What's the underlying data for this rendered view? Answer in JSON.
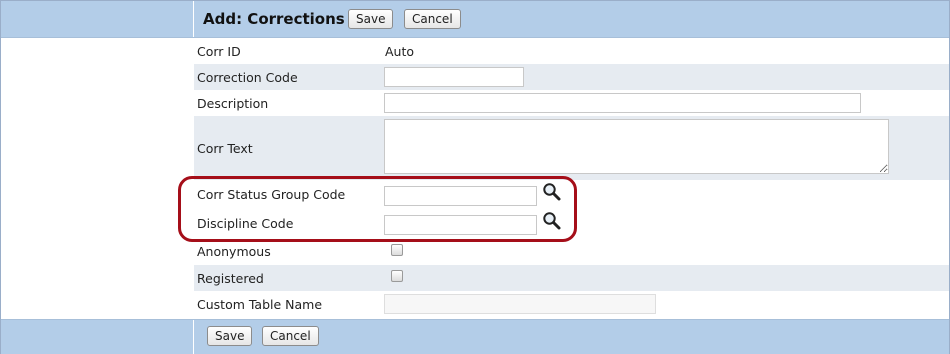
{
  "header": {
    "title": "Add: Corrections",
    "save_label": "Save",
    "cancel_label": "Cancel"
  },
  "fields": {
    "corr_id": {
      "label": "Corr ID",
      "value": "Auto"
    },
    "correction_code": {
      "label": "Correction Code",
      "value": ""
    },
    "description": {
      "label": "Description",
      "value": ""
    },
    "corr_text": {
      "label": "Corr Text",
      "value": ""
    },
    "corr_status_group_code": {
      "label": "Corr Status Group Code",
      "value": ""
    },
    "discipline_code": {
      "label": "Discipline Code",
      "value": ""
    },
    "anonymous": {
      "label": "Anonymous",
      "checked": false
    },
    "registered": {
      "label": "Registered",
      "checked": false
    },
    "custom_table_name": {
      "label": "Custom Table Name",
      "value": ""
    }
  },
  "footer": {
    "save_label": "Save",
    "cancel_label": "Cancel"
  },
  "icons": {
    "lookup": "magnifier-icon"
  },
  "colors": {
    "header_bg": "#b3cde8",
    "alt_row_bg": "#e6ebf1",
    "highlight": "#a50e19"
  }
}
